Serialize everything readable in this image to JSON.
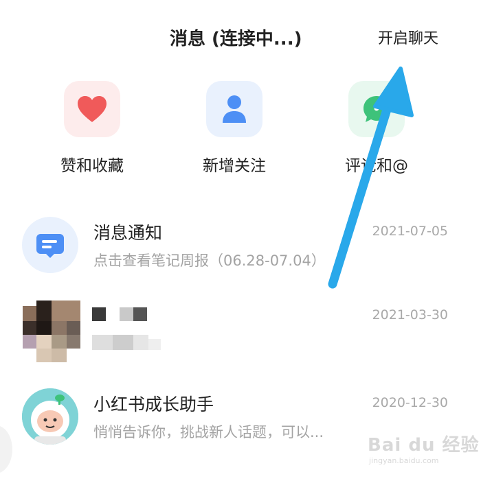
{
  "header": {
    "title": "消息 (连接中...)",
    "action_label": "开启聊天"
  },
  "categories": [
    {
      "label": "赞和收藏",
      "icon": "heart-icon",
      "color": "#f05a5a",
      "bg": "#fdecec"
    },
    {
      "label": "新增关注",
      "icon": "person-icon",
      "color": "#4d8ff5",
      "bg": "#e9f1fd"
    },
    {
      "label": "评论和@",
      "icon": "comment-icon",
      "color": "#3ec27a",
      "bg": "#e8f8ef"
    }
  ],
  "messages": [
    {
      "title": "消息通知",
      "subtitle": "点击查看笔记周报（06.28-07.04）",
      "date": "2021-07-05",
      "avatar": "notification-icon"
    },
    {
      "title": "",
      "subtitle": "",
      "date": "2021-03-30",
      "avatar": "pixelated-avatar"
    },
    {
      "title": "小红书成长助手",
      "subtitle": "悄悄告诉你，挑战新人话题，可以...",
      "date": "2020-12-30",
      "avatar": "astronaut-avatar"
    }
  ],
  "watermark": {
    "text": "Bai du 经验",
    "sub": "jingyan.baidu.com"
  },
  "colors": {
    "arrow": "#29a8ea"
  }
}
